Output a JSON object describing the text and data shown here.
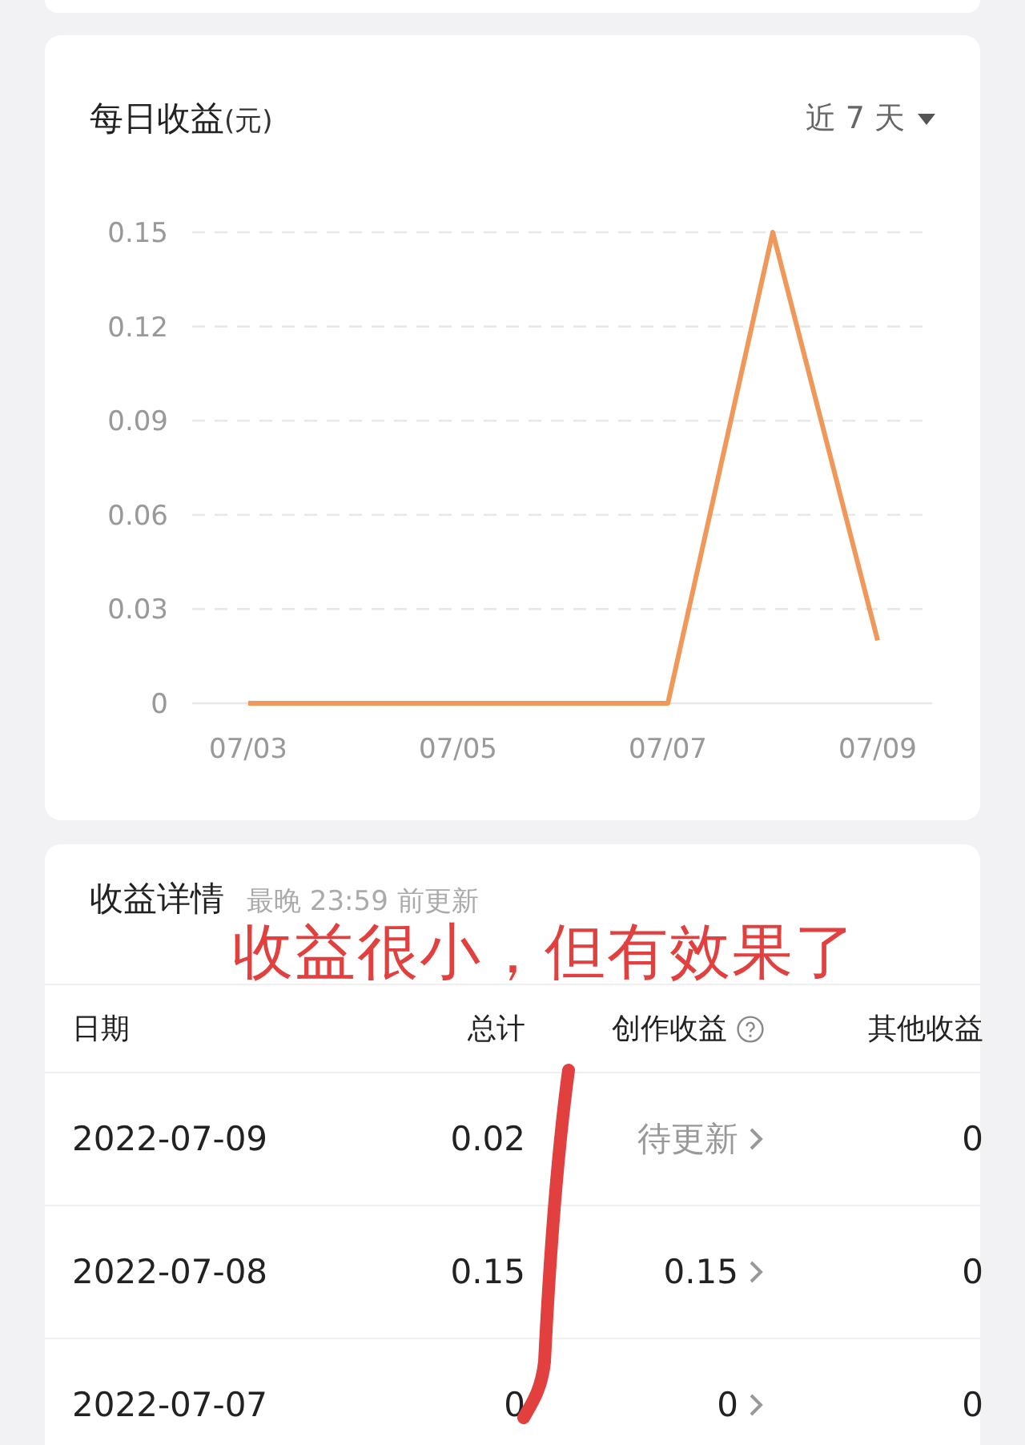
{
  "daily_earnings": {
    "title": "每日收益",
    "unit": "(元)",
    "range_selector": "近 7 天",
    "chart_data": {
      "type": "line",
      "grid": true,
      "categories": [
        "07/03",
        null,
        "07/05",
        null,
        "07/07",
        null,
        "07/09"
      ],
      "series": [
        {
          "color": "#f0985a",
          "values": [
            0,
            0,
            0,
            0,
            0,
            0.15,
            0.02
          ]
        }
      ],
      "ylim": [
        0,
        0.15
      ],
      "yticks": [
        {
          "value": 0,
          "label": "0"
        },
        {
          "value": 0.03,
          "label": "0.03"
        },
        {
          "value": 0.06,
          "label": "0.06"
        },
        {
          "value": 0.09,
          "label": "0.09"
        },
        {
          "value": 0.12,
          "label": "0.12"
        },
        {
          "value": 0.15,
          "label": "0.15"
        }
      ]
    }
  },
  "earnings_details": {
    "title": "收益详情",
    "subtitle": "最晚 23:59 前更新",
    "columns": [
      "日期",
      "总计",
      "创作收益",
      "其他收益"
    ],
    "rows": [
      {
        "date": "2022-07-09",
        "total": "0.02",
        "creation": "待更新",
        "other": "0",
        "pending": true
      },
      {
        "date": "2022-07-08",
        "total": "0.15",
        "creation": "0.15",
        "other": "0",
        "pending": false
      },
      {
        "date": "2022-07-07",
        "total": "0",
        "creation": "0",
        "other": "0",
        "pending": false
      }
    ]
  },
  "annotation": {
    "text": "收益很小，但有效果了"
  }
}
